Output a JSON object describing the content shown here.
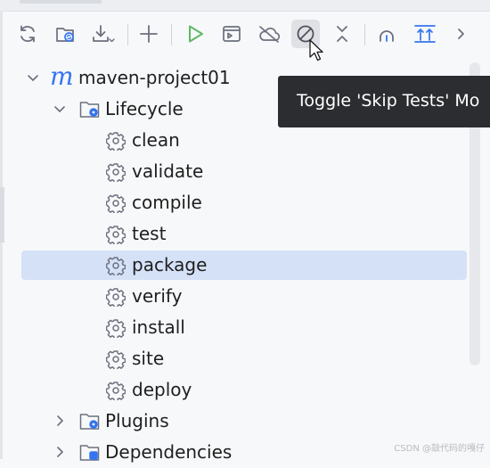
{
  "toolbar": {
    "buttons": [
      {
        "icon": "reload-icon",
        "tooltip": ""
      },
      {
        "icon": "generate-sources-icon",
        "tooltip": ""
      },
      {
        "icon": "download-icon",
        "tooltip": ""
      },
      {
        "icon": "add-icon",
        "tooltip": ""
      },
      {
        "icon": "run-icon",
        "tooltip": ""
      },
      {
        "icon": "execute-goal-icon",
        "tooltip": ""
      },
      {
        "icon": "offline-mode-icon",
        "tooltip": ""
      },
      {
        "icon": "skip-tests-icon",
        "tooltip": "Toggle 'Skip Tests' Mo"
      },
      {
        "icon": "collapse-all-icon",
        "tooltip": ""
      },
      {
        "icon": "analyze-dependencies-icon",
        "tooltip": ""
      },
      {
        "icon": "show-diagram-icon",
        "tooltip": ""
      },
      {
        "icon": "more-chevron-icon",
        "tooltip": ""
      }
    ],
    "hovered": "skip-tests-icon"
  },
  "tooltip": {
    "text": "Toggle 'Skip Tests' Mo"
  },
  "tree": {
    "project": {
      "label": "maven-project01",
      "expanded": true
    },
    "lifecycle": {
      "label": "Lifecycle",
      "expanded": true
    },
    "phases": [
      "clean",
      "validate",
      "compile",
      "test",
      "package",
      "verify",
      "install",
      "site",
      "deploy"
    ],
    "selected_phase": "package",
    "plugins": {
      "label": "Plugins",
      "expanded": false
    },
    "dependencies": {
      "label": "Dependencies",
      "expanded": false
    }
  },
  "colors": {
    "accent": "#3574f0",
    "run_green": "#5fb865",
    "selection": "#d5e1f7",
    "tooltip_bg": "#2b2d30",
    "icon_gray": "#6c707e"
  },
  "watermark": "CSDN @敲代码的嘎仔"
}
